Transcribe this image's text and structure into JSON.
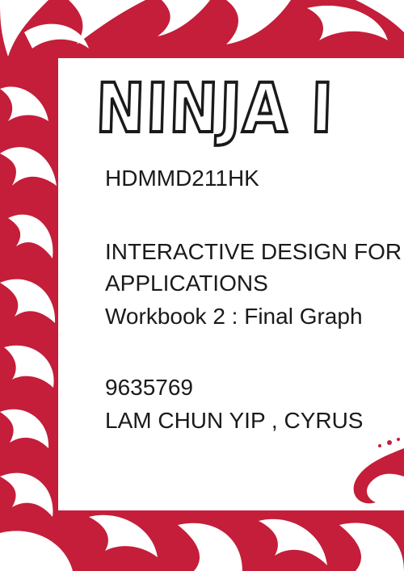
{
  "cover": {
    "title": "NINJA I",
    "course_code": "HDMMD211HK",
    "subject_line_1": "INTERACTIVE DESIGN FOR",
    "subject_line_2": "APPLICATIONS",
    "workbook_line": "Workbook 2 : Final Graph",
    "student_id": "9635769",
    "student_name": "LAM CHUN YIP , CYRUS"
  },
  "colors": {
    "accent_red": "#c41e3a",
    "ink": "#1a1a1a",
    "paper": "#ffffff"
  }
}
